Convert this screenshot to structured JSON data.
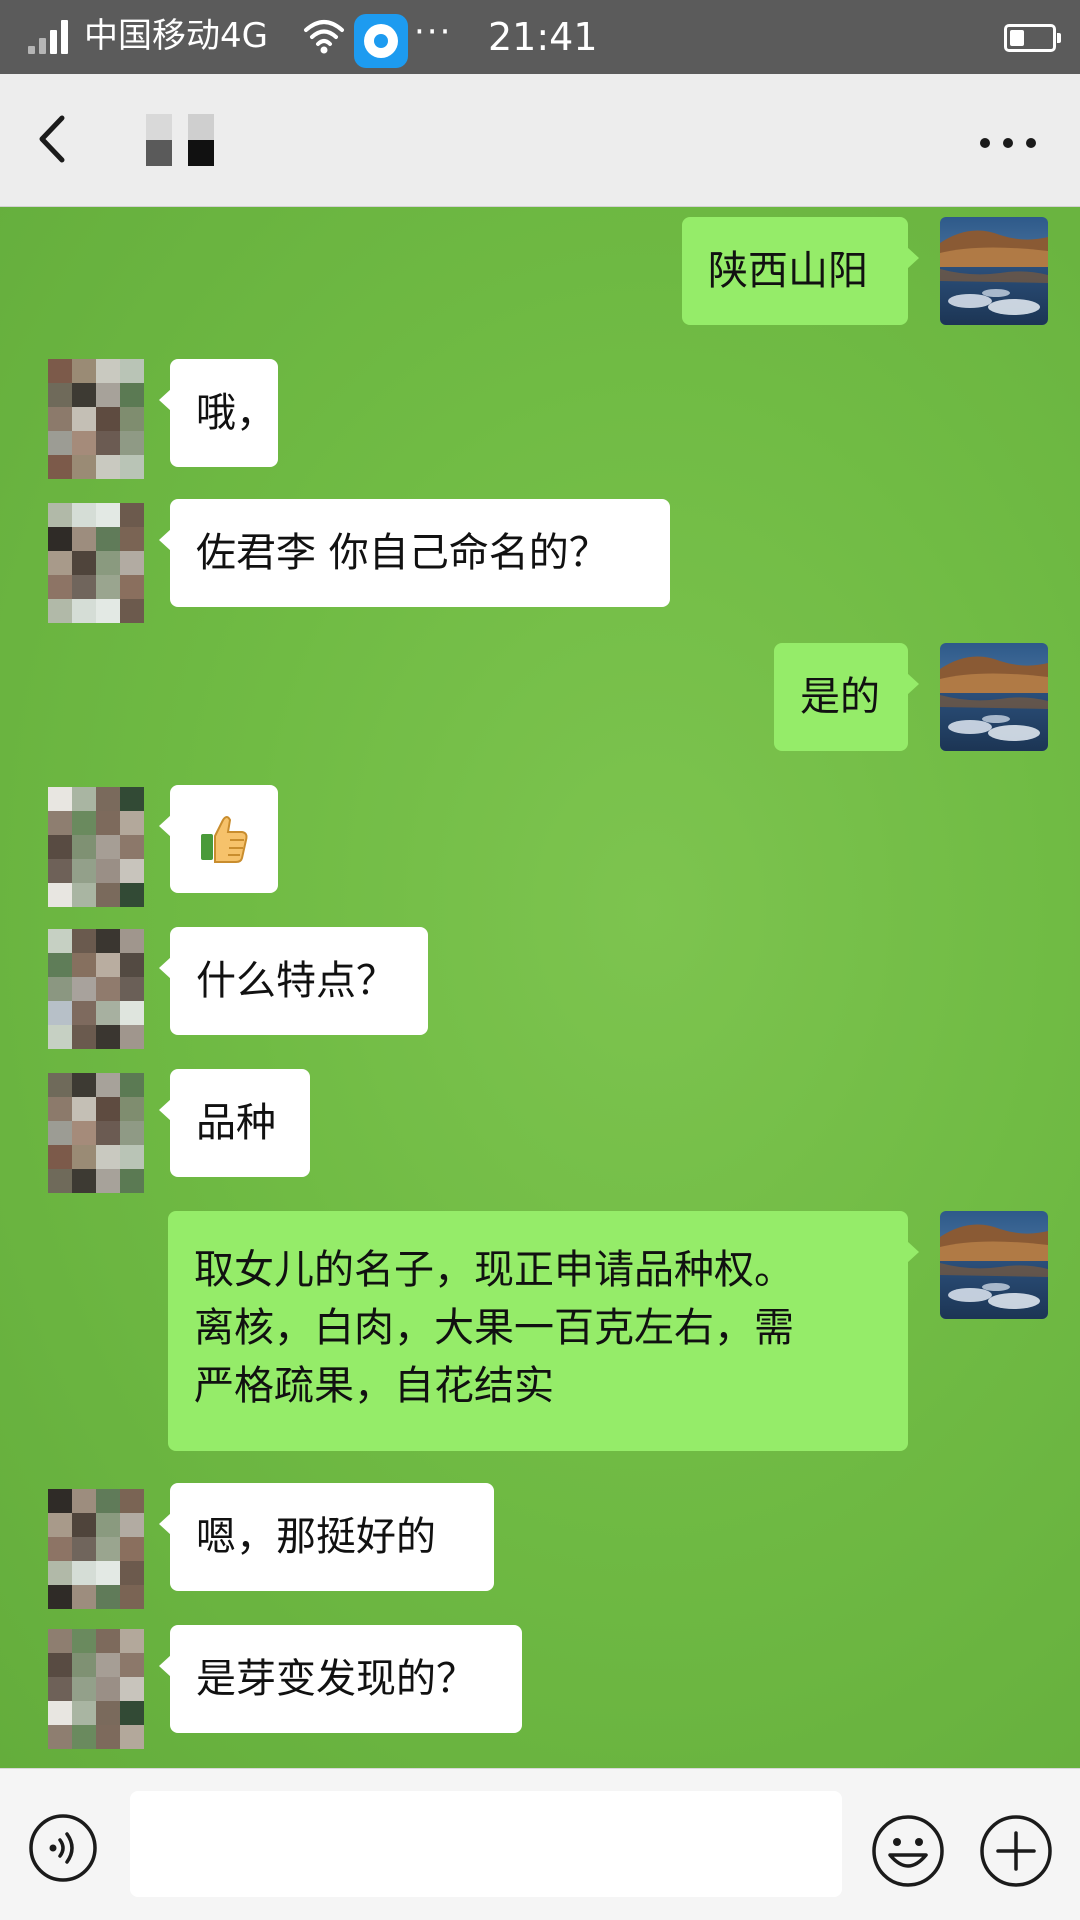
{
  "status_bar": {
    "carrier": "中国移动4G",
    "more": "···",
    "time": "21:41",
    "battery_level": 0.35
  },
  "header": {
    "back_icon": "back-icon",
    "more_icon": "more-icon"
  },
  "messages": [
    {
      "side": "right",
      "text": "陕西山阳"
    },
    {
      "side": "left",
      "text": "哦，"
    },
    {
      "side": "left",
      "text": "佐君李 你自己命名的？"
    },
    {
      "side": "right",
      "text": "是的"
    },
    {
      "side": "left",
      "text": "",
      "emoji": "thumbs-up-emoji"
    },
    {
      "side": "left",
      "text": "什么特点？"
    },
    {
      "side": "left",
      "text": "品种"
    },
    {
      "side": "right",
      "text_lines": [
        "取女儿的名子，现正申请品种权。",
        "离核，白肉，大果一百克左右，需",
        "严格疏果，自花结实"
      ]
    },
    {
      "side": "left",
      "text": "嗯，那挺好的"
    },
    {
      "side": "left",
      "text": "是芽变发现的？"
    }
  ],
  "input_bar": {
    "voice_icon": "voice-icon",
    "message_value": "",
    "emoji_icon": "emoji-icon",
    "add_icon": "add-icon"
  },
  "colors": {
    "chat_background": "#72bd46",
    "incoming_bubble": "#ffffff",
    "outgoing_bubble": "#95ec69",
    "status_bar": "#5b5b5b",
    "header_background": "#ededed"
  }
}
